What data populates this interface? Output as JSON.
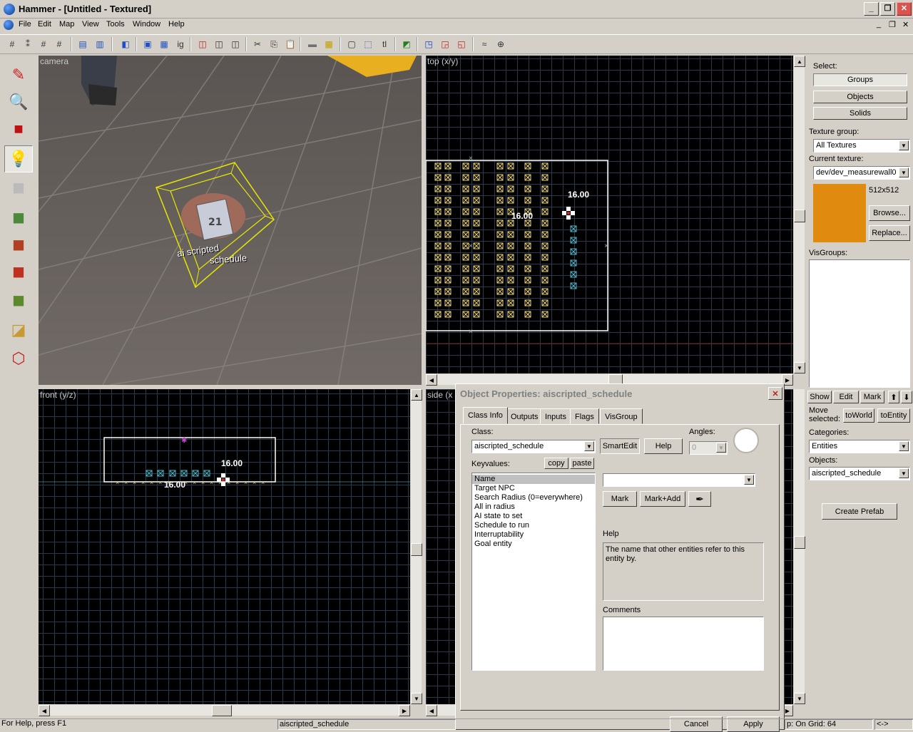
{
  "window": {
    "title": "Hammer - [Untitled - Textured]"
  },
  "menu": [
    "File",
    "Edit",
    "Map",
    "View",
    "Tools",
    "Window",
    "Help"
  ],
  "viewports": {
    "camera": "camera",
    "top": "top (x/y)",
    "front": "front (y/z)",
    "side": "side (x"
  },
  "camera": {
    "entity_label_1": "ai scripted",
    "entity_label_2": "schedule"
  },
  "measure": {
    "top_w": "16.00",
    "top_h": "16.00",
    "front_w": "16.00",
    "front_h": "16.00"
  },
  "right_panel": {
    "select_label": "Select:",
    "groups": "Groups",
    "objects": "Objects",
    "solids": "Solids",
    "texture_group_label": "Texture group:",
    "texture_group": "All Textures",
    "current_texture_label": "Current texture:",
    "current_texture": "dev/dev_measurewall0",
    "texture_size": "512x512",
    "browse": "Browse...",
    "replace": "Replace...",
    "visgroups_label": "VisGroups:",
    "show": "Show",
    "edit": "Edit",
    "mark": "Mark",
    "move_selected": "Move selected:",
    "to_world": "toWorld",
    "to_entity": "toEntity",
    "categories_label": "Categories:",
    "categories": "Entities",
    "objects_label": "Objects:",
    "objects_value": "aiscripted_schedule",
    "create_prefab": "Create Prefab"
  },
  "dialog": {
    "title": "Object Properties: aiscripted_schedule",
    "tabs": [
      "Class Info",
      "Outputs",
      "Inputs",
      "Flags",
      "VisGroup"
    ],
    "class_label": "Class:",
    "class_value": "aiscripted_schedule",
    "smartedit": "SmartEdit",
    "help_btn": "Help",
    "angles_label": "Angles:",
    "angles_value": "0",
    "keyvalues_label": "Keyvalues:",
    "copy": "copy",
    "paste": "paste",
    "keyvalues": [
      "Name",
      "Target NPC",
      "Search Radius (0=everywhere)",
      "All in radius",
      "AI state to set",
      "Schedule to run",
      "Interruptability",
      "Goal entity"
    ],
    "mark": "Mark",
    "mark_add": "Mark+Add",
    "help_label": "Help",
    "help_text": "The name that other entities refer to this entity by.",
    "comments_label": "Comments",
    "cancel": "Cancel",
    "apply": "Apply"
  },
  "status": {
    "help": "For Help, press F1",
    "selection": "aiscripted_schedule",
    "grid": "p: On Grid: 64",
    "arrows": "<->"
  },
  "colors": {
    "grid": "#2a3a4a",
    "selection": "#ffffff",
    "brush": "#e6d27a",
    "entity": "#4fb8c8",
    "camera_floor": "#6a6460",
    "texture_swatch": "#e08a10"
  }
}
